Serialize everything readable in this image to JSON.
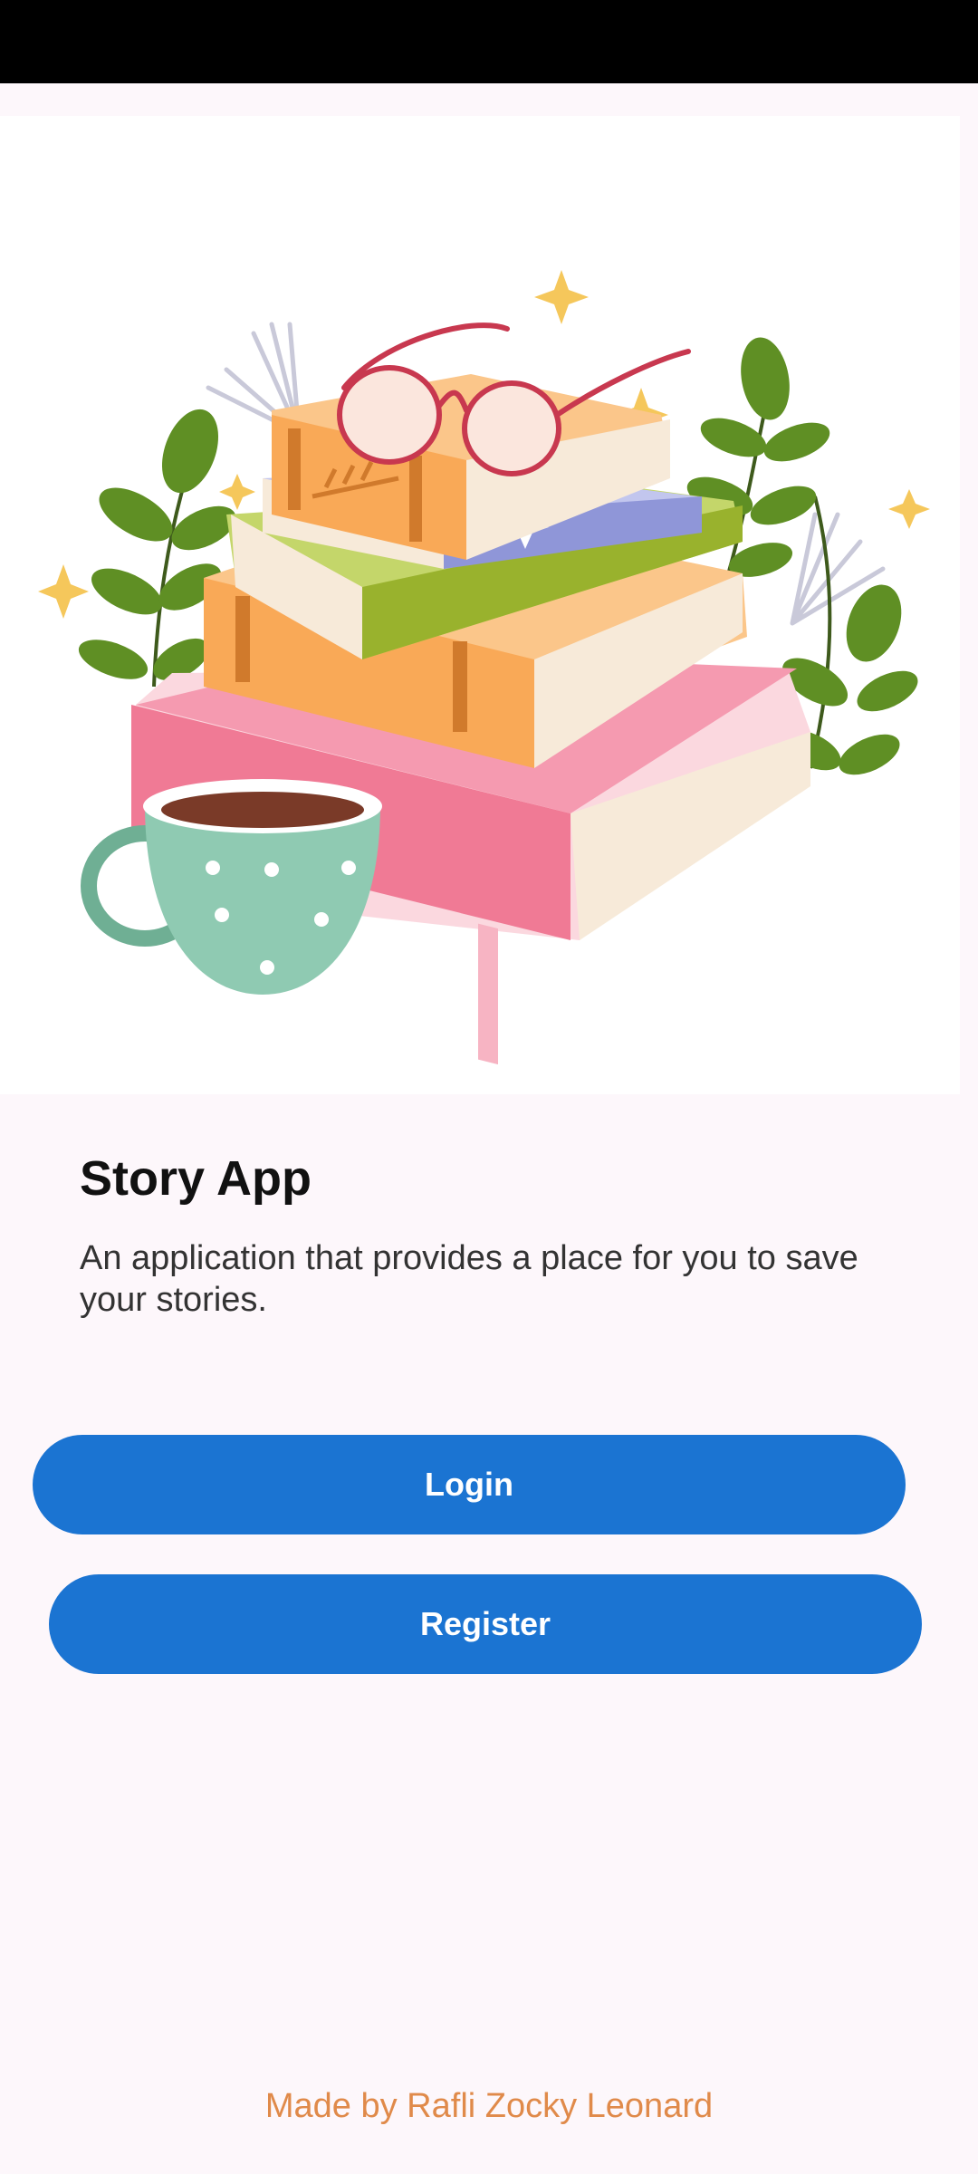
{
  "app": {
    "title": "Story App",
    "description": "An application that provides a place for you to save your stories."
  },
  "hero_image": {
    "icon": "books-with-glasses-and-coffee-illustration",
    "colors": {
      "pink_book": "#f07a95",
      "orange_book": "#f9a957",
      "green_book": "#99b22d",
      "blue_book": "#8f96d8",
      "cup": "#8fcab2",
      "leaf": "#5f8f24",
      "sparkle": "#f5c75b",
      "glasses": "#c8384f"
    }
  },
  "buttons": {
    "login_label": "Login",
    "register_label": "Register"
  },
  "footer": {
    "credit": "Made by Rafli Zocky Leonard"
  },
  "colors": {
    "primary": "#1b74d2",
    "background": "#fdf7fb",
    "footer_text": "#e08a4a"
  }
}
